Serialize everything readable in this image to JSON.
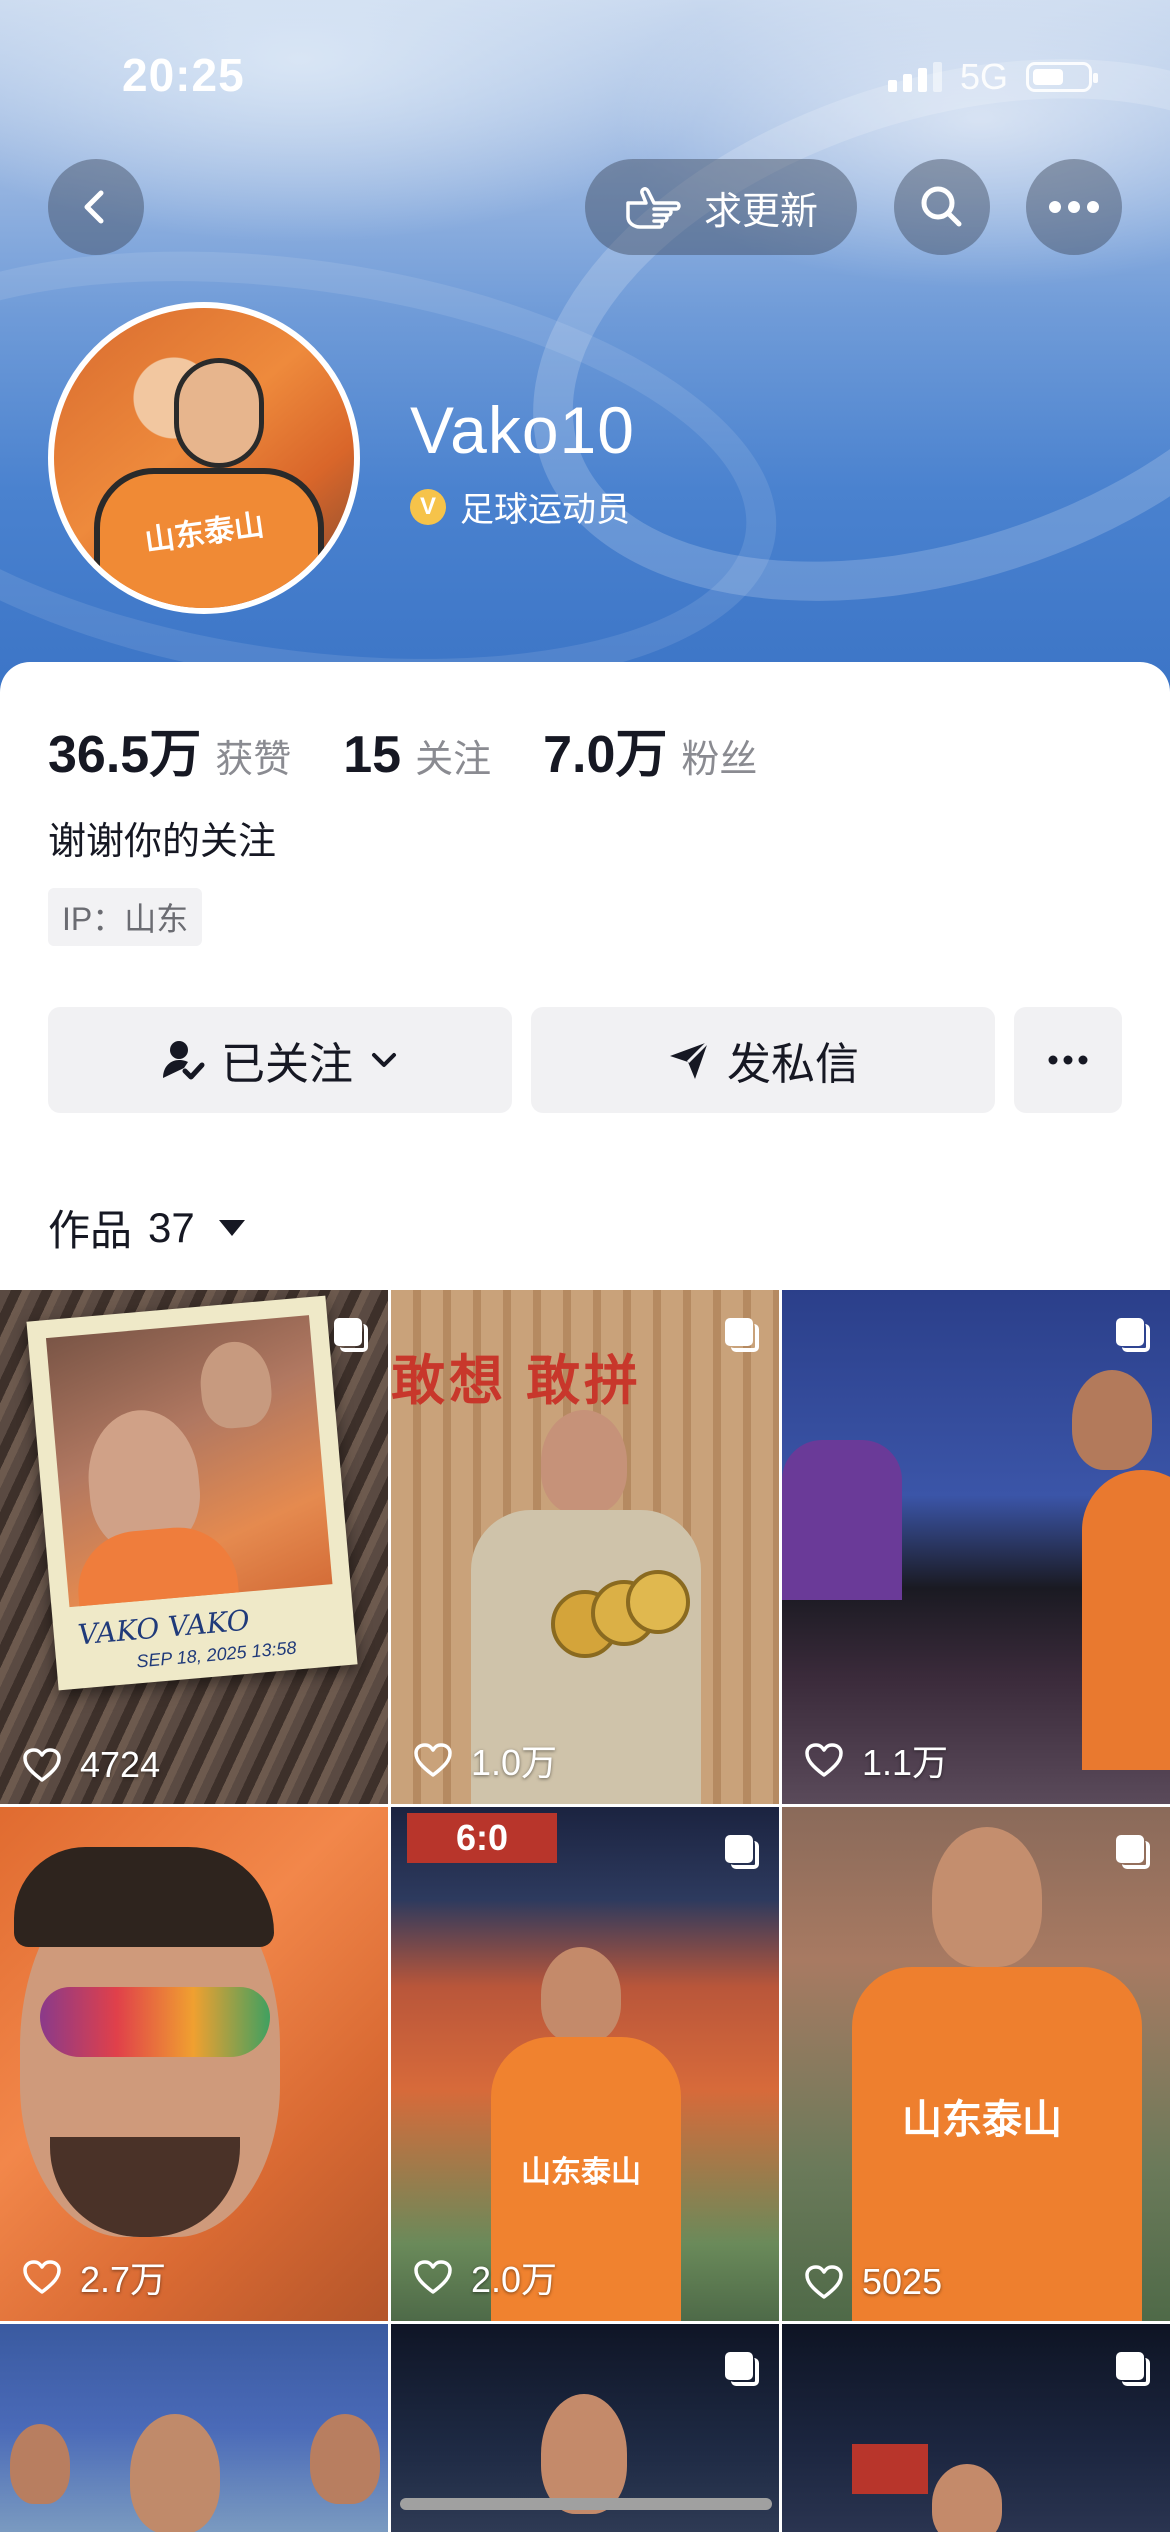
{
  "status_bar": {
    "time": "20:25",
    "network": "5G"
  },
  "header": {
    "request_update_label": "求更新",
    "username": "Vako10",
    "verification": "足球运动员",
    "verify_badge": "V",
    "avatar_text": "山东泰山"
  },
  "stats": [
    {
      "value": "36.5万",
      "label": "获赞"
    },
    {
      "value": "15",
      "label": "关注"
    },
    {
      "value": "7.0万",
      "label": "粉丝"
    }
  ],
  "bio": "谢谢你的关注",
  "ip": "IP：山东",
  "actions": {
    "follow": "已关注",
    "message": "发私信"
  },
  "works": {
    "label": "作品",
    "count": "37"
  },
  "posts": [
    {
      "likes": "4724"
    },
    {
      "likes": "1.0万"
    },
    {
      "likes": "1.1万"
    },
    {
      "likes": "2.7万"
    },
    {
      "likes": "2.0万"
    },
    {
      "likes": "5025"
    }
  ],
  "photo_text": {
    "polaroid_caption": "VAKO VAKO",
    "polaroid_date": "SEP 18, 2025 13:58",
    "banner_text": "敢想 敢拼",
    "score": "6:0",
    "jersey_text": "山东泰山"
  },
  "colors": {
    "brand_orange": "#f0822f",
    "text_primary": "#161823",
    "text_secondary": "#8a8b91"
  }
}
